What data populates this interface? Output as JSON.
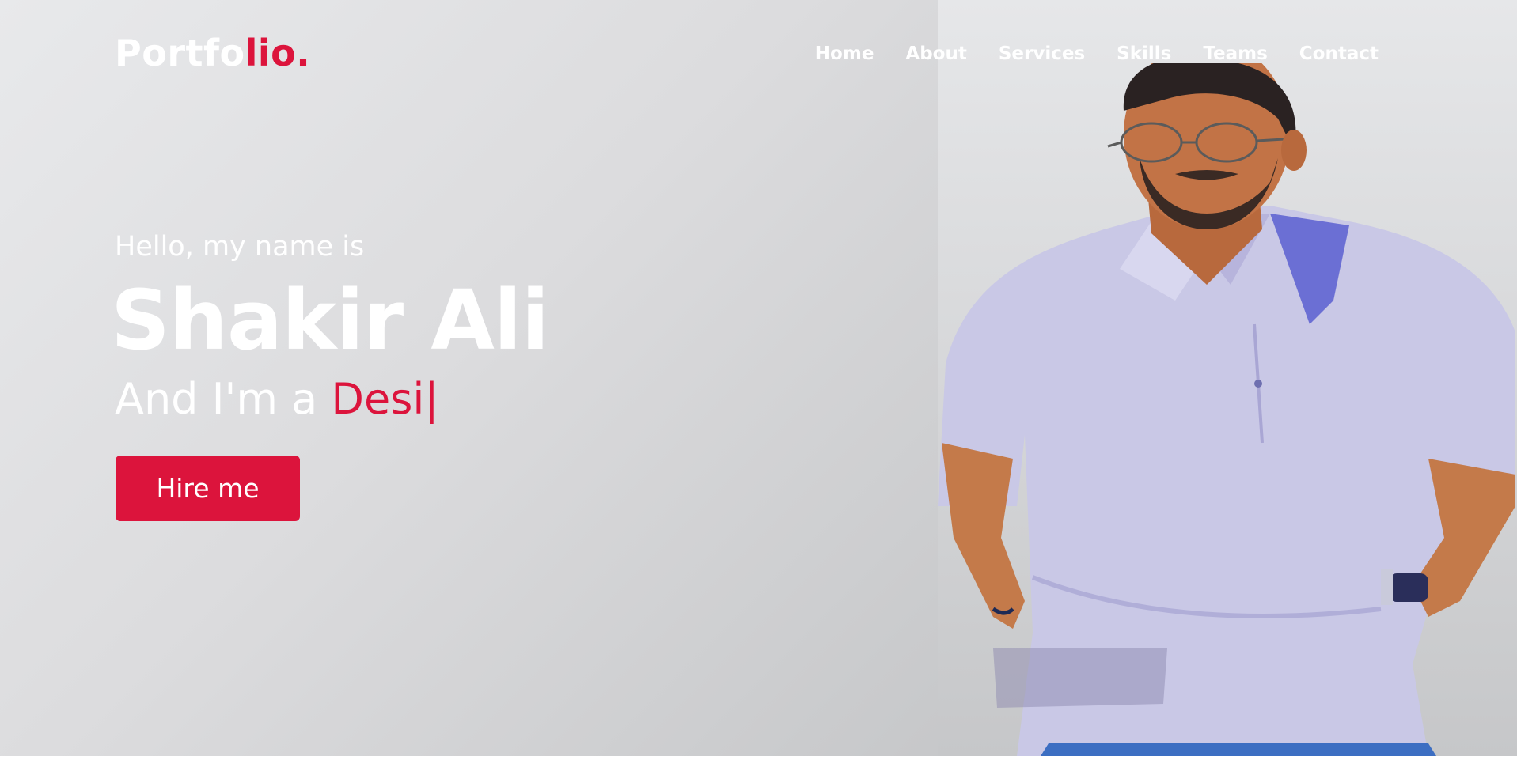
{
  "logo": {
    "text_main": "Portfo",
    "text_accent": "lio."
  },
  "nav": {
    "items": [
      {
        "label": "Home"
      },
      {
        "label": "About"
      },
      {
        "label": "Services"
      },
      {
        "label": "Skills"
      },
      {
        "label": "Teams"
      },
      {
        "label": "Contact"
      }
    ]
  },
  "hero": {
    "greeting": "Hello, my name is",
    "name": "Shakir Ali",
    "role_prefix": "And I'm a",
    "role_typed": "Desi",
    "cursor": "|",
    "cta_label": "Hire me"
  },
  "colors": {
    "accent": "#dc143c",
    "text": "#ffffff"
  },
  "icons": [
    "portrait-photo"
  ]
}
